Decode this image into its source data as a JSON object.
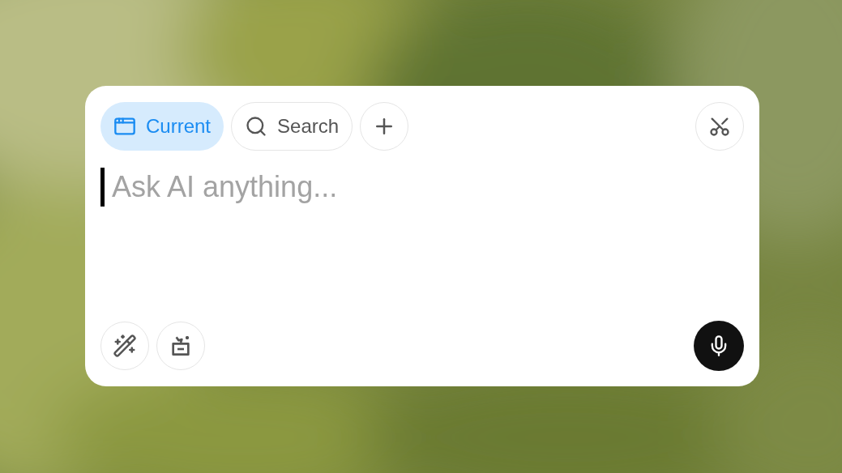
{
  "tabs": [
    {
      "label": "Current",
      "selected": true,
      "kind": "window"
    },
    {
      "label": "Search",
      "selected": false,
      "kind": "search"
    }
  ],
  "prompt": {
    "placeholder": "Ask AI anything..."
  }
}
